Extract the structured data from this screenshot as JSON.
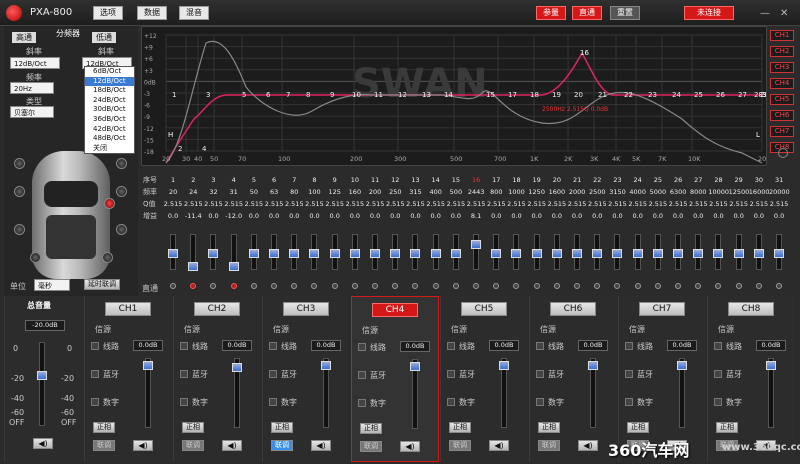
{
  "title_bar": {
    "app_name": "PXA-800",
    "menu": [
      "选项",
      "数据",
      "混音"
    ],
    "mode_buttons": [
      "参量",
      "直通",
      "重置"
    ],
    "connect": "未连接",
    "window_controls": [
      "—",
      "✕"
    ]
  },
  "left": {
    "tabs": {
      "high": "高通",
      "divider": "分频器",
      "low": "低通"
    },
    "slope_label": "斜率",
    "high_slope": "12dB/Oct",
    "low_slope": "12dB/Oct",
    "freq_label": "频率",
    "freq_value": "20Hz",
    "type_label": "类型",
    "type_value": "贝塞尔",
    "slope_options": [
      "6dB/Oct",
      "12dB/Oct",
      "18dB/Oct",
      "24dB/Oct",
      "30dB/Oct",
      "36dB/Oct",
      "42dB/Oct",
      "48dB/Oct",
      "关闭"
    ],
    "unit_label": "单位",
    "unit_value": "毫秒",
    "delay_button": "延时联调"
  },
  "graph": {
    "watermark": "SWAN",
    "y_ticks": [
      "+12",
      "+9",
      "+6",
      "+3",
      "0dB",
      "-3",
      "-6",
      "-9",
      "-12",
      "-15",
      "-18"
    ],
    "x_ticks": [
      "20",
      "30",
      "40",
      "50",
      "70",
      "100",
      "200",
      "300",
      "500",
      "700",
      "1K",
      "2K",
      "3K",
      "4K",
      "5K",
      "7K",
      "10K",
      "20K"
    ],
    "point_labels": [
      "H",
      "2",
      "4",
      "1",
      "3",
      "5",
      "6",
      "7",
      "8",
      "9",
      "10",
      "11",
      "12",
      "13",
      "14",
      "15",
      "17",
      "18",
      "19",
      "20",
      "21",
      "22",
      "23",
      "24",
      "25",
      "26",
      "27",
      "28",
      "29",
      "30",
      "31",
      "16",
      "L"
    ],
    "marker_info": "2500Hz 2.515Q 0.0dB",
    "channels": [
      "CH1",
      "CH2",
      "CH3",
      "CH4",
      "CH5",
      "CH6",
      "CH7",
      "CH8"
    ]
  },
  "eq_table": {
    "row_labels": [
      "序号",
      "频率",
      "Q值",
      "增益"
    ],
    "index": [
      "1",
      "2",
      "3",
      "4",
      "5",
      "6",
      "7",
      "8",
      "9",
      "10",
      "11",
      "12",
      "13",
      "14",
      "15",
      "16",
      "17",
      "18",
      "19",
      "20",
      "21",
      "22",
      "23",
      "24",
      "25",
      "26",
      "27",
      "28",
      "29",
      "30",
      "31"
    ],
    "freq": [
      "20",
      "24",
      "32",
      "31",
      "50",
      "63",
      "80",
      "100",
      "125",
      "160",
      "200",
      "250",
      "315",
      "400",
      "500",
      "2443",
      "800",
      "1000",
      "1250",
      "1600",
      "2000",
      "2500",
      "3150",
      "4000",
      "5000",
      "6300",
      "8000",
      "10000",
      "12500",
      "16000",
      "20000"
    ],
    "q": [
      "2.515",
      "2.515",
      "2.515",
      "2.515",
      "2.515",
      "2.515",
      "2.515",
      "2.515",
      "2.515",
      "2.515",
      "2.515",
      "2.515",
      "2.515",
      "2.515",
      "2.515",
      "2.515",
      "2.515",
      "2.515",
      "2.515",
      "2.515",
      "2.515",
      "2.515",
      "2.515",
      "2.515",
      "2.515",
      "2.515",
      "2.515",
      "2.515",
      "2.515",
      "2.515",
      "2.515"
    ],
    "gain": [
      "0.0",
      "-11.4",
      "0.0",
      "-12.0",
      "0.0",
      "0.0",
      "0.0",
      "0.0",
      "0.0",
      "0.0",
      "0.0",
      "0.0",
      "0.0",
      "0.0",
      "0.0",
      "8.1",
      "0.0",
      "0.0",
      "0.0",
      "0.0",
      "0.0",
      "0.0",
      "0.0",
      "0.0",
      "0.0",
      "0.0",
      "0.0",
      "0.0",
      "0.0",
      "0.0",
      "0.0"
    ],
    "bypass_label": "直通"
  },
  "master": {
    "label": "总音量",
    "value": "-20.0dB",
    "scale": [
      "0",
      "-20",
      "-40",
      "-60",
      "OFF"
    ],
    "scale_right": [
      "0",
      "-20",
      "-40",
      "-60",
      "OFF"
    ],
    "level": 0.65
  },
  "channels": [
    {
      "name": "CH1",
      "source": "信源",
      "line": "线路",
      "bt": "蓝牙",
      "digital": "数字",
      "val": "0.0dB",
      "phase": "正相",
      "link": "联调"
    },
    {
      "name": "CH2",
      "source": "信源",
      "line": "线路",
      "bt": "蓝牙",
      "digital": "数字",
      "val": "0.0dB",
      "phase": "正相",
      "link": "联调"
    },
    {
      "name": "CH3",
      "source": "信源",
      "line": "线路",
      "bt": "蓝牙",
      "digital": "数字",
      "val": "0.0dB",
      "phase": "正相",
      "link": "联调"
    },
    {
      "name": "CH4",
      "source": "信源",
      "line": "线路",
      "bt": "蓝牙",
      "digital": "数字",
      "val": "0.0dB",
      "phase": "正相",
      "link": "联调"
    },
    {
      "name": "CH5",
      "source": "信源",
      "line": "线路",
      "bt": "蓝牙",
      "digital": "数字",
      "val": "0.0dB",
      "phase": "正相",
      "link": "联调"
    },
    {
      "name": "CH6",
      "source": "信源",
      "line": "线路",
      "bt": "蓝牙",
      "digital": "数字",
      "val": "0.0dB",
      "phase": "正相",
      "link": "联调"
    },
    {
      "name": "CH7",
      "source": "信源",
      "line": "线路",
      "bt": "蓝牙",
      "digital": "数字",
      "val": "0.0dB",
      "phase": "正相",
      "link": "联调"
    },
    {
      "name": "CH8",
      "source": "信源",
      "line": "线路",
      "bt": "蓝牙",
      "digital": "数字",
      "val": "0.0dB",
      "phase": "正相",
      "link": "联调"
    }
  ],
  "footer": {
    "watermark": "360汽车网",
    "site": "www.360qc.com"
  },
  "colors": {
    "accent": "#d41818",
    "blue": "#3b8ee8",
    "curve": "#e0245e"
  }
}
